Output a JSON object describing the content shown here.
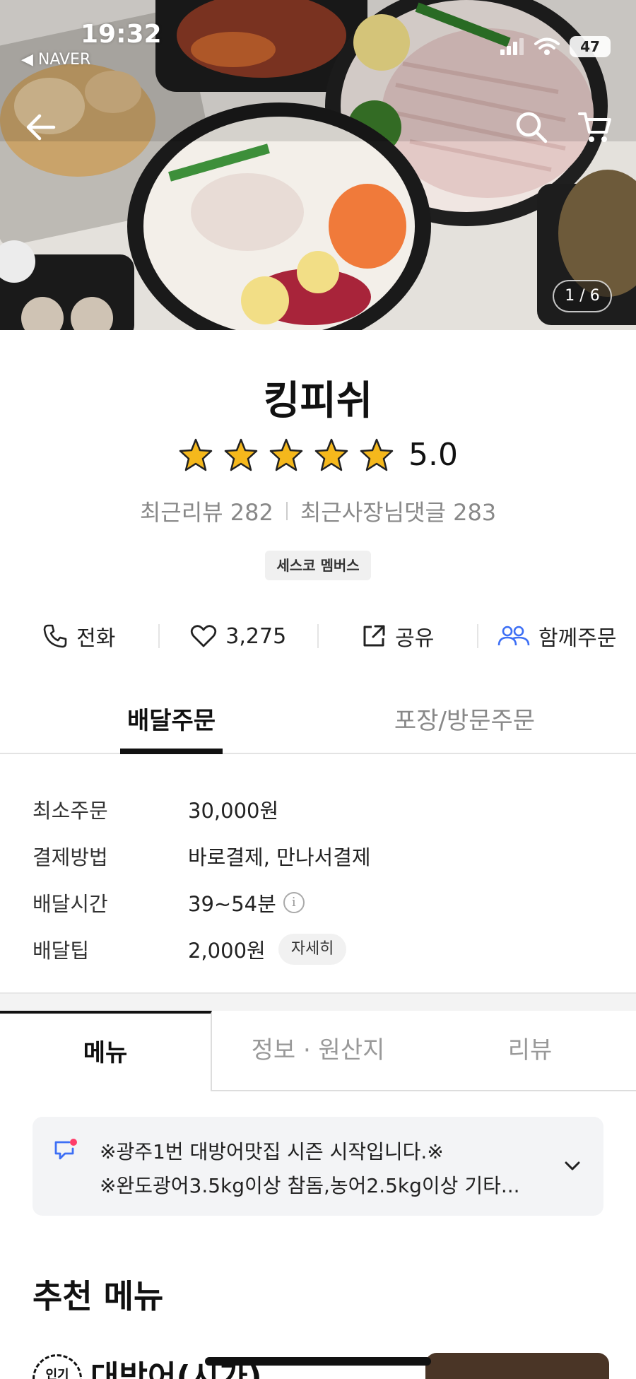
{
  "status_bar": {
    "time": "19:32",
    "back_app": "◀ NAVER",
    "battery": "47"
  },
  "hero": {
    "page_counter": "1 / 6"
  },
  "store": {
    "name": "킹피쉬",
    "rating": "5.0",
    "rating_stars": 5,
    "recent_reviews": "최근리뷰 282",
    "owner_replies": "최근사장님댓글 283",
    "badge": "세스코 멤버스"
  },
  "actions": {
    "call": "전화",
    "likes": "3,275",
    "share": "공유",
    "group_order": "함께주문"
  },
  "order_tabs": {
    "delivery": "배달주문",
    "pickup": "포장/방문주문"
  },
  "delivery_info": {
    "rows": [
      {
        "label": "최소주문",
        "value": "30,000원"
      },
      {
        "label": "결제방법",
        "value": "바로결제, 만나서결제"
      },
      {
        "label": "배달시간",
        "value": "39~54분"
      },
      {
        "label": "배달팁",
        "value": "2,000원"
      }
    ],
    "info_icon": "i",
    "detail_button": "자세히"
  },
  "section_tabs": {
    "menu": "메뉴",
    "info": "정보 · 원산지",
    "reviews": "리뷰"
  },
  "notice": {
    "line1": "※광주1번 대방어맛집 시즌 시작입니다.※",
    "line2": "※완도광어3.5kg이상 참돔,농어2.5kg이상 기타..."
  },
  "recommended": {
    "title": "추천 메뉴",
    "first_item_name": "대방어(시가)",
    "first_item_badge": "인기"
  },
  "colors": {
    "accent_blue": "#3d6ff5",
    "star": "#f5b81c",
    "notice_dot": "#ff3d6a"
  }
}
